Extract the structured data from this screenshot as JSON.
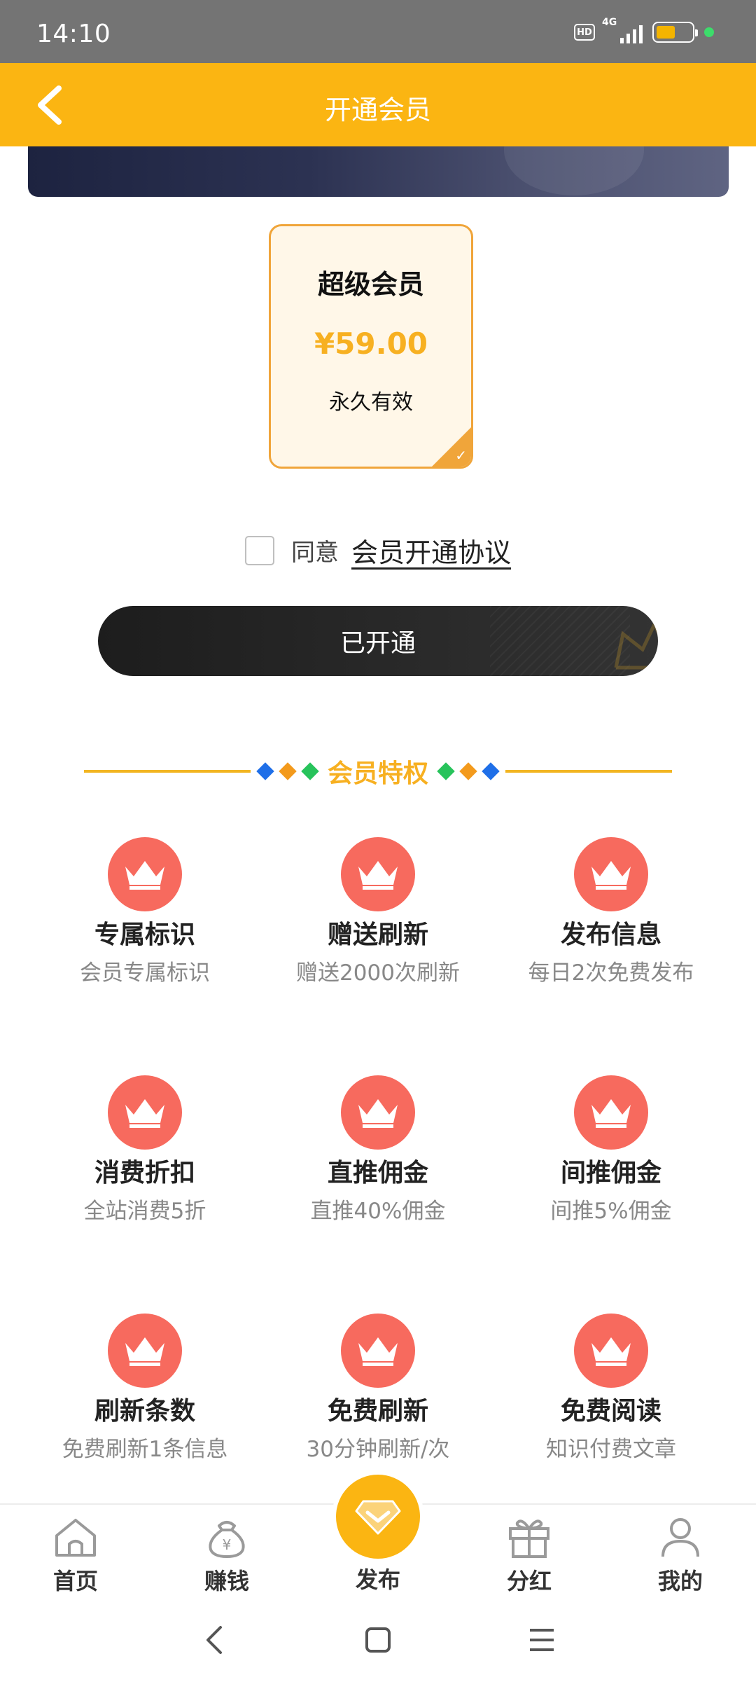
{
  "status_bar": {
    "time": "14:10",
    "hd": "HD",
    "network": "4G"
  },
  "header": {
    "title": "开通会员"
  },
  "plan": {
    "name": "超级会员",
    "price": "¥59.00",
    "validity": "永久有效"
  },
  "agreement": {
    "prefix": "同意",
    "link": "会员开通协议"
  },
  "action": {
    "label": "已开通"
  },
  "privileges": {
    "title": "会员特权",
    "items": [
      {
        "name": "专属标识",
        "desc": "会员专属标识"
      },
      {
        "name": "赠送刷新",
        "desc": "赠送2000次刷新"
      },
      {
        "name": "发布信息",
        "desc": "每日2次免费发布"
      },
      {
        "name": "消费折扣",
        "desc": "全站消费5折"
      },
      {
        "name": "直推佣金",
        "desc": "直推40%佣金"
      },
      {
        "name": "间推佣金",
        "desc": "间推5%佣金"
      },
      {
        "name": "刷新条数",
        "desc": "免费刷新1条信息"
      },
      {
        "name": "免费刷新",
        "desc": "30分钟刷新/次"
      },
      {
        "name": "免费阅读",
        "desc": "知识付费文章"
      }
    ]
  },
  "bottom_nav": {
    "home": "首页",
    "earn": "赚钱",
    "publish": "发布",
    "dividend": "分红",
    "mine": "我的"
  },
  "colors": {
    "accent": "#fbb512",
    "crown_bg": "#f76a5e",
    "price": "#f7b021"
  }
}
